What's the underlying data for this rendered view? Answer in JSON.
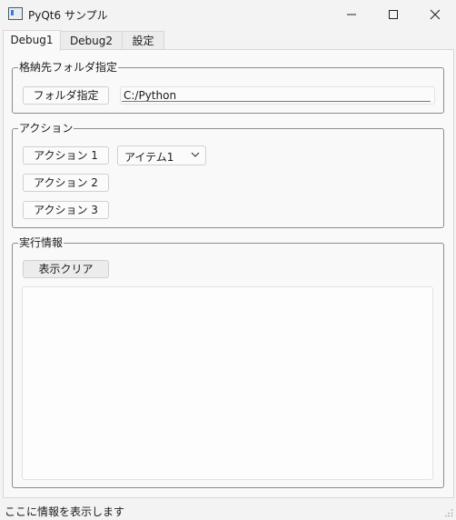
{
  "window": {
    "title": "PyQt6 サンプル",
    "icon": "app-window-icon",
    "controls": {
      "minimize": "—",
      "maximize": "☐",
      "close": "✕"
    }
  },
  "tabs": [
    {
      "label": "Debug1",
      "active": true
    },
    {
      "label": "Debug2",
      "active": false
    },
    {
      "label": "設定",
      "active": false
    }
  ],
  "folder_group": {
    "title": "格納先フォルダ指定",
    "button_label": "フォルダ指定",
    "path_value": "C:/Python"
  },
  "action_group": {
    "title": "アクション",
    "buttons": [
      "アクション 1",
      "アクション 2",
      "アクション 3"
    ],
    "combo_value": "アイテム1"
  },
  "info_group": {
    "title": "実行情報",
    "clear_button_label": "表示クリア",
    "log_text": ""
  },
  "statusbar": {
    "message": "ここに情報を表示します"
  }
}
